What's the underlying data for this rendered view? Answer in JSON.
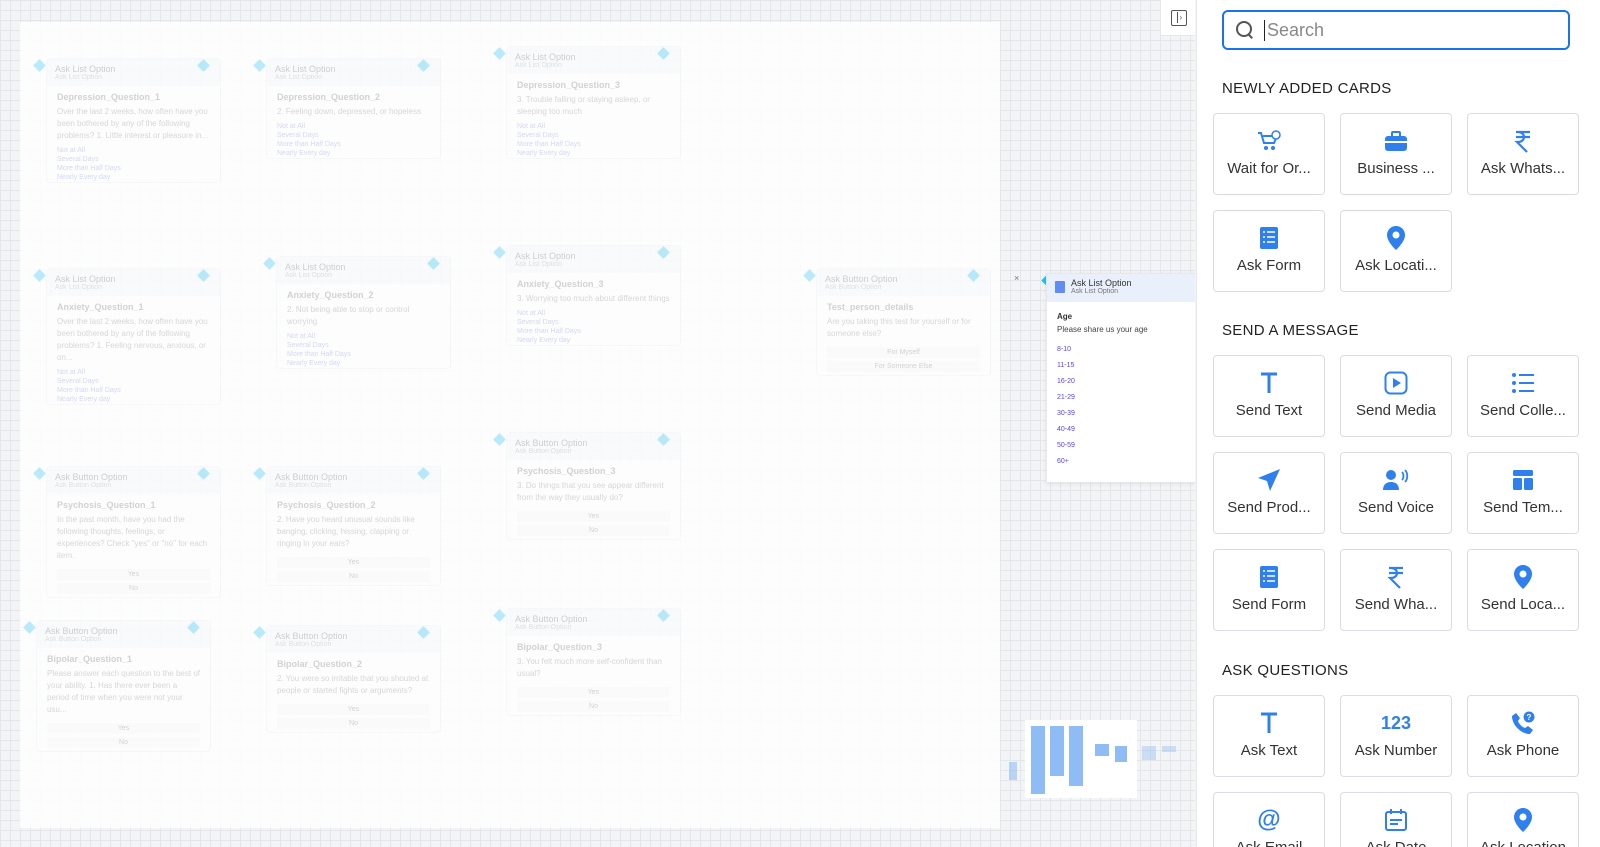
{
  "canvas": {
    "nodes": [
      {
        "header": "Ask List Option",
        "sub": "Ask List Option",
        "title": "Depression_Question_1",
        "question": "Over the last 2 weeks, how often have you been bothered by any of the following problems? 1. Little interest or pleasure in...",
        "options": [
          "Not at All",
          "Several Days",
          "More than Half Days",
          "Nearly Every day"
        ]
      },
      {
        "header": "Ask List Option",
        "sub": "Ask List Option",
        "title": "Depression_Question_2",
        "question": "2. Feeling down, depressed, or hopeless",
        "options": [
          "Not at All",
          "Several Days",
          "More than Half Days",
          "Nearly Every day"
        ]
      },
      {
        "header": "Ask List Option",
        "sub": "Ask List Option",
        "title": "Depression_Question_3",
        "question": "3. Trouble falling or staying asleep, or sleeping too much",
        "options": [
          "Not at All",
          "Several Days",
          "More than Half Days",
          "Nearly Every day"
        ]
      },
      {
        "header": "Ask List Option",
        "sub": "Ask List Option",
        "title": "Anxiety_Question_1",
        "question": "Over the last 2 weeks, how often have you been bothered by any of the following problems? 1. Feeling nervous, anxious, or on...",
        "options": [
          "Not at All",
          "Several Days",
          "More than Half Days",
          "Nearly Every day"
        ]
      },
      {
        "header": "Ask List Option",
        "sub": "Ask List Option",
        "title": "Anxiety_Question_2",
        "question": "2. Not being able to stop or control worrying",
        "options": [
          "Not at All",
          "Several Days",
          "More than Half Days",
          "Nearly Every day"
        ]
      },
      {
        "header": "Ask List Option",
        "sub": "Ask List Option",
        "title": "Anxiety_Question_3",
        "question": "3. Worrying too much about different things",
        "options": [
          "Not at All",
          "Several Days",
          "More than Half Days",
          "Nearly Every day"
        ]
      },
      {
        "header": "Ask Button Option",
        "sub": "Ask Button Option",
        "title": "Test_person_details",
        "question": "Are you taking this test for yourself or for someone else?",
        "buttons": [
          "For Myself",
          "For Someone Else"
        ]
      },
      {
        "header": "Ask Button Option",
        "sub": "Ask Button Option",
        "title": "Psychosis_Question_1",
        "question": "In the past month, have you had the following thoughts, feelings, or experiences? Check \"yes\" or \"no\" for each item.",
        "buttons": [
          "Yes",
          "No"
        ]
      },
      {
        "header": "Ask Button Option",
        "sub": "Ask Button Option",
        "title": "Psychosis_Question_2",
        "question": "2. Have you heard unusual sounds like banging, clicking, hissing, clapping or ringing in your ears?",
        "buttons": [
          "Yes",
          "No"
        ]
      },
      {
        "header": "Ask Button Option",
        "sub": "Ask Button Option",
        "title": "Psychosis_Question_3",
        "question": "3. Do things that you see appear different from the way they usually do?",
        "buttons": [
          "Yes",
          "No"
        ]
      },
      {
        "header": "Ask Button Option",
        "sub": "Ask Button Option",
        "title": "Bipolar_Question_1",
        "question": "Please answer each question to the best of your ability. 1. Has there ever been a period of time when you were not your usu...",
        "buttons": [
          "Yes",
          "No"
        ]
      },
      {
        "header": "Ask Button Option",
        "sub": "Ask Button Option",
        "title": "Bipolar_Question_2",
        "question": "2. You were so irritable that you shouted at people or started fights or arguments?",
        "buttons": [
          "Yes",
          "No"
        ]
      },
      {
        "header": "Ask Button Option",
        "sub": "Ask Button Option",
        "title": "Bipolar_Question_3",
        "question": "3. You felt much more self-confident than usual?",
        "buttons": [
          "Yes",
          "No"
        ]
      }
    ],
    "focus_node": {
      "header": "Ask List Option",
      "sub": "Ask List Option",
      "title": "Age",
      "question": "Please share us your age",
      "options": [
        "8-10",
        "11-15",
        "16-20",
        "21-29",
        "30-39",
        "40-49",
        "50-59",
        "60+"
      ]
    },
    "close_glyph": "×"
  },
  "sidebar": {
    "search_placeholder": "Search",
    "sections": [
      {
        "title": "NEWLY ADDED CARDS",
        "cards": [
          {
            "label": "Wait for Or...",
            "icon": "cart-clock-icon"
          },
          {
            "label": "Business ...",
            "icon": "briefcase-icon"
          },
          {
            "label": "Ask Whats...",
            "icon": "rupee-icon"
          },
          {
            "label": "Ask Form",
            "icon": "form-icon"
          },
          {
            "label": "Ask Locati...",
            "icon": "location-pin-icon"
          }
        ]
      },
      {
        "title": "SEND A MESSAGE",
        "cards": [
          {
            "label": "Send Text",
            "icon": "text-t-icon"
          },
          {
            "label": "Send Media",
            "icon": "media-play-icon"
          },
          {
            "label": "Send Colle...",
            "icon": "list-icon"
          },
          {
            "label": "Send Prod...",
            "icon": "send-arrow-icon"
          },
          {
            "label": "Send Voice",
            "icon": "voice-icon"
          },
          {
            "label": "Send Tem...",
            "icon": "template-icon"
          },
          {
            "label": "Send Form",
            "icon": "form-icon"
          },
          {
            "label": "Send Wha...",
            "icon": "rupee-icon"
          },
          {
            "label": "Send Loca...",
            "icon": "location-pin-icon"
          }
        ]
      },
      {
        "title": "ASK QUESTIONS",
        "cards": [
          {
            "label": "Ask Text",
            "icon": "text-t-icon"
          },
          {
            "label": "Ask Number",
            "icon": "number-123-icon",
            "glyph": "123"
          },
          {
            "label": "Ask Phone",
            "icon": "phone-question-icon"
          },
          {
            "label": "Ask Email",
            "icon": "at-sign-icon",
            "glyph": "@"
          },
          {
            "label": "Ask Date",
            "icon": "calendar-icon"
          },
          {
            "label": "Ask Location",
            "icon": "location-pin-icon"
          }
        ]
      }
    ]
  },
  "colors": {
    "accent": "#1a73e8",
    "icon_blue": "#2f80ed",
    "connector_diamond": "#22c1ee"
  }
}
